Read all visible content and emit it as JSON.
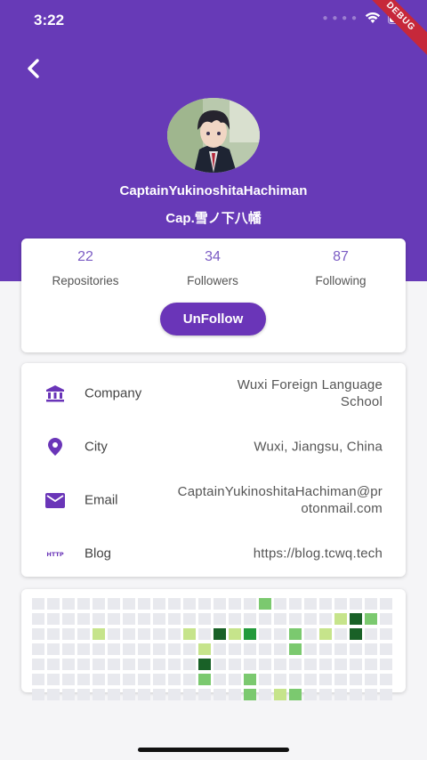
{
  "status_bar": {
    "time": "3:22",
    "debug_label": "DEBUG"
  },
  "profile": {
    "username": "CaptainYukinoshitaHachiman",
    "nickname": "Cap.雪ノ下八幡"
  },
  "stats": [
    {
      "value": "22",
      "label": "Repositories"
    },
    {
      "value": "34",
      "label": "Followers"
    },
    {
      "value": "87",
      "label": "Following"
    }
  ],
  "unfollow_label": "UnFollow",
  "info": [
    {
      "icon": "bank-icon",
      "label": "Company",
      "value_lines": [
        "Wuxi Foreign Language",
        "School"
      ]
    },
    {
      "icon": "location-pin-icon",
      "label": "City",
      "value_lines": [
        "Wuxi, Jiangsu, China"
      ]
    },
    {
      "icon": "email-icon",
      "label": "Email",
      "value_lines": [
        "CaptainYukinoshitaHachiman@pr",
        "otonmail.com"
      ]
    },
    {
      "icon": "http-icon",
      "label": "Blog",
      "value_lines": [
        "https://blog.tcwq.tech"
      ]
    }
  ],
  "colors": {
    "primary": "#673ab7",
    "button": "#6a35b8",
    "empty_cell": "#e8e9ee",
    "level1": "#c6e48b",
    "level2": "#7bc96f",
    "level3": "#239a3b",
    "level4": "#196127"
  },
  "contributions": {
    "weeks": 24,
    "days": 7,
    "active": [
      {
        "w": 15,
        "d": 0,
        "level": 2
      },
      {
        "w": 20,
        "d": 1,
        "level": 1
      },
      {
        "w": 21,
        "d": 1,
        "level": 4
      },
      {
        "w": 22,
        "d": 1,
        "level": 2
      },
      {
        "w": 4,
        "d": 2,
        "level": 1
      },
      {
        "w": 10,
        "d": 2,
        "level": 1
      },
      {
        "w": 12,
        "d": 2,
        "level": 4
      },
      {
        "w": 13,
        "d": 2,
        "level": 1
      },
      {
        "w": 14,
        "d": 2,
        "level": 3
      },
      {
        "w": 17,
        "d": 2,
        "level": 2
      },
      {
        "w": 19,
        "d": 2,
        "level": 1
      },
      {
        "w": 21,
        "d": 2,
        "level": 4
      },
      {
        "w": 11,
        "d": 3,
        "level": 1
      },
      {
        "w": 17,
        "d": 3,
        "level": 2
      },
      {
        "w": 11,
        "d": 4,
        "level": 4
      },
      {
        "w": 11,
        "d": 5,
        "level": 2
      },
      {
        "w": 14,
        "d": 5,
        "level": 2
      },
      {
        "w": 14,
        "d": 6,
        "level": 2
      },
      {
        "w": 16,
        "d": 6,
        "level": 1
      },
      {
        "w": 17,
        "d": 6,
        "level": 2
      }
    ]
  }
}
